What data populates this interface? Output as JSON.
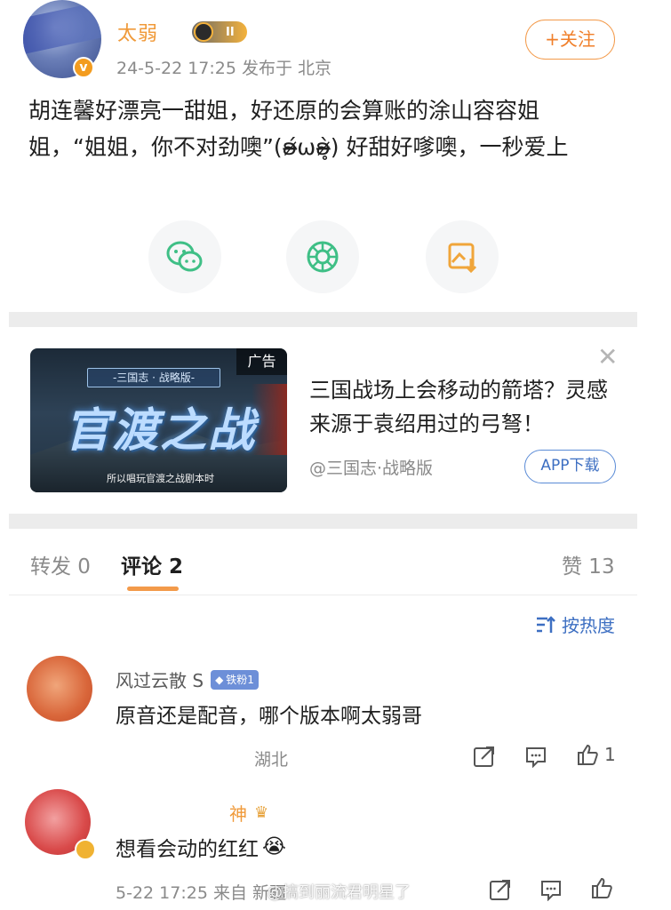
{
  "post": {
    "username": "太弱",
    "level": "II",
    "meta": "24-5-22 17:25  发布于 北京",
    "follow_label": "+关注",
    "body": "胡连馨好漂亮一甜姐，好还原的会算账的涂山容容姐姐，“姐姐，你不对劲噢”(ʚ̴̶̷́ωʚ̴̶̷̥̀) 好甜好嗲噢，一秒爱上",
    "share_icons": [
      "wechat-icon",
      "moments-icon",
      "save-image-icon"
    ]
  },
  "ad": {
    "tag": "广告",
    "image_subtitle": "-三国志 · 战略版-",
    "image_logo": "官渡之战",
    "image_caption": "所以唱玩官渡之战剧本时",
    "text": "三国战场上会移动的箭塔？灵感来源于袁绍用过的弓弩！",
    "source": "@三国志·战略版",
    "cta_label": "APP下载"
  },
  "tabs": {
    "repost": "转发 0",
    "comments": "评论 2",
    "likes": "赞 13"
  },
  "sort_label": "按热度",
  "comments": [
    {
      "name": "风过云散 S",
      "badge": "铁粉1",
      "text": "原音还是配音，哪个版本啊太弱哥",
      "meta": "湖北",
      "like_count": "1"
    },
    {
      "name": "神",
      "text": "想看会动的红红",
      "emoji": "😭",
      "meta": "5-22 17:25  来自 新疆",
      "like_count": ""
    }
  ],
  "watermark": "@搞到丽流君明星了",
  "colors": {
    "accent_orange": "#f39a4a",
    "link_blue": "#3d6fc2",
    "divider": "#ececec"
  }
}
